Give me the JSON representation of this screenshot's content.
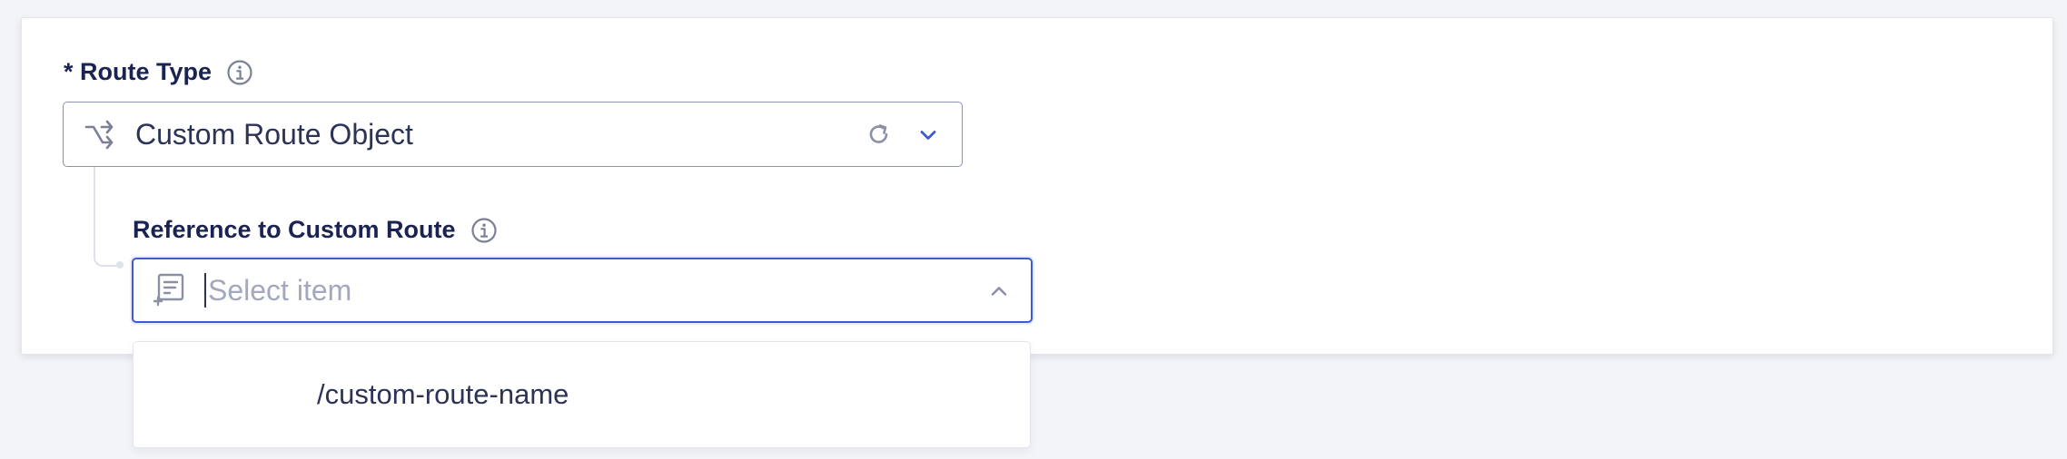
{
  "route_type": {
    "label": "* Route Type",
    "info_icon": "info-icon",
    "value": "Custom Route Object",
    "icons": [
      "route-icon",
      "reset-icon",
      "chevron-down-icon"
    ]
  },
  "reference": {
    "label": "Reference to Custom Route",
    "info_icon": "info-icon",
    "placeholder": "Select item",
    "icons": [
      "document-add-icon",
      "chevron-up-icon"
    ]
  },
  "dropdown": {
    "options": [
      {
        "label": "/custom-route-name"
      }
    ]
  },
  "colors": {
    "label": "#1b2352",
    "focus_border": "#3f5bd4",
    "accent": "#3f5bd4",
    "text": "#2c3356",
    "placeholder": "#a3a8bd"
  }
}
